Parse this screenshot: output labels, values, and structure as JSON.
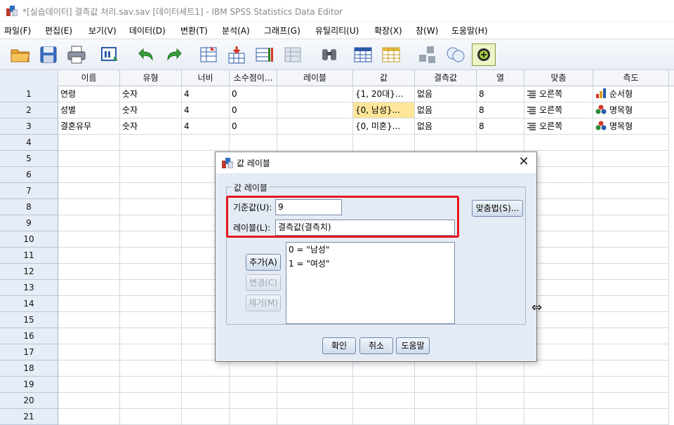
{
  "window": {
    "title": "*[실습데이터] 결측값 처리.sav.sav [데이터세트1] - IBM SPSS Statistics Data Editor"
  },
  "menu": {
    "items": [
      {
        "label": "파일(F)"
      },
      {
        "label": "편집(E)"
      },
      {
        "label": "보기(V)"
      },
      {
        "label": "데이터(D)"
      },
      {
        "label": "변환(T)"
      },
      {
        "label": "분석(A)"
      },
      {
        "label": "그래프(G)"
      },
      {
        "label": "유틸리티(U)"
      },
      {
        "label": "확장(X)"
      },
      {
        "label": "창(W)"
      },
      {
        "label": "도움말(H)"
      }
    ]
  },
  "toolbar": {
    "icons": [
      "open-folder-icon",
      "save-icon",
      "print-icon",
      "recall-dialog-icon",
      "undo-icon",
      "redo-icon",
      "goto-case-icon",
      "goto-variable-icon",
      "variables-icon",
      "weight-cases-icon",
      "find-icon",
      "insert-cases-icon",
      "insert-variable-icon",
      "split-file-icon",
      "value-labels-icon",
      "use-variable-sets-icon",
      "custom-icon"
    ]
  },
  "grid": {
    "columns": [
      "이름",
      "유형",
      "너비",
      "소수점이...",
      "레이블",
      "값",
      "결측값",
      "열",
      "맞춤",
      "측도"
    ],
    "rows": [
      {
        "num": "1",
        "name": "연령",
        "type": "숫자",
        "width": "4",
        "decimals": "0",
        "label": "",
        "values": "{1, 20대}...",
        "missing": "없음",
        "columns": "8",
        "align": "오른쪽",
        "measure": "순서형",
        "measure_icon": "ordinal"
      },
      {
        "num": "2",
        "name": "성별",
        "type": "숫자",
        "width": "4",
        "decimals": "0",
        "label": "",
        "values": "{0, 남성}...",
        "missing": "없음",
        "columns": "8",
        "align": "오른쪽",
        "measure": "명목형",
        "measure_icon": "nominal"
      },
      {
        "num": "3",
        "name": "결혼유무",
        "type": "숫자",
        "width": "4",
        "decimals": "0",
        "label": "",
        "values": "{0, 미혼}...",
        "missing": "없음",
        "columns": "8",
        "align": "오른쪽",
        "measure": "명목형",
        "measure_icon": "nominal"
      }
    ],
    "empty_row_numbers": [
      "4",
      "5",
      "6",
      "7",
      "8",
      "9",
      "10",
      "11",
      "12",
      "13",
      "14",
      "15",
      "16",
      "17",
      "18",
      "19",
      "20",
      "21"
    ]
  },
  "dialog": {
    "title": "값 레이블",
    "group_label": "값 레이블",
    "value_label": "기준값(U):",
    "value_input": "9",
    "label_label": "레이블(L):",
    "label_input": "결측값(결측치)",
    "spelling_button": "맞춤법(S)...",
    "add_button": "추가(A)",
    "change_button": "변경(C)",
    "remove_button": "제거(M)",
    "list_items": [
      "0 = \"남성\"",
      "1 = \"여성\""
    ],
    "ok_button": "확인",
    "cancel_button": "취소",
    "help_button": "도움말"
  },
  "colors": {
    "selected_cell": "#fde59a",
    "highlight_box": "#e8141b",
    "dialog_bg": "#e4ebf5"
  }
}
